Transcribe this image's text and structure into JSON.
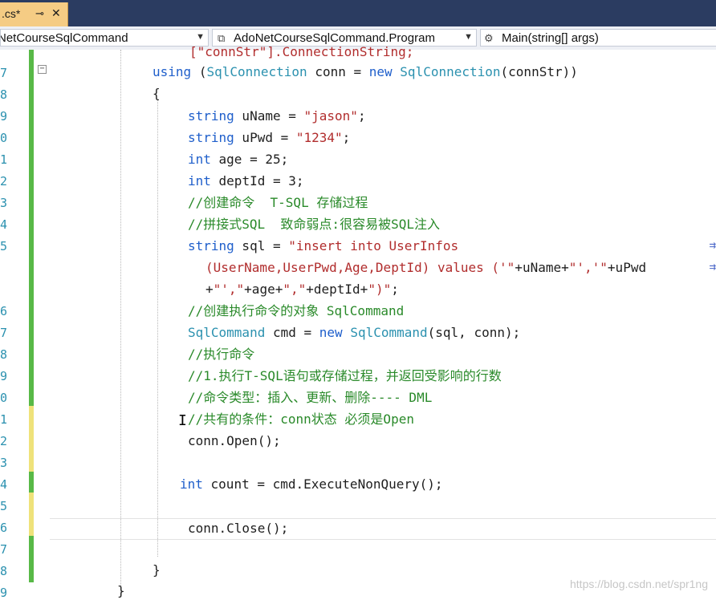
{
  "tab": {
    "title": ".cs*",
    "pin": "⊸",
    "close": "✕"
  },
  "nav": {
    "project": "NetCourseSqlCommand",
    "class": "AdoNetCourseSqlCommand.Program",
    "member": "Main(string[] args)"
  },
  "line_numbers": [
    "7",
    "8",
    "9",
    "0",
    "1",
    "2",
    "3",
    "4",
    "5",
    "6",
    "7",
    "8",
    "9",
    "0",
    "1",
    "2",
    "3",
    "4",
    "5",
    "6",
    "7",
    "8",
    "9"
  ],
  "code": {
    "l0": "[\"connStr\"].ConnectionString;",
    "l1_kw": "using",
    "l1_a": "(",
    "l1_ty": "SqlConnection",
    "l1_b": " conn = ",
    "l1_new": "new",
    "l1_ty2": "SqlConnection",
    "l1_c": "(connStr))",
    "l2": "{",
    "l3_kw": "string",
    "l3_a": " uName = ",
    "l3_st": "\"jason\"",
    "l3_b": ";",
    "l4_kw": "string",
    "l4_a": " uPwd = ",
    "l4_st": "\"1234\"",
    "l4_b": ";",
    "l5_kw": "int",
    "l5_a": " age = 25;",
    "l6_kw": "int",
    "l6_a": " deptId = 3;",
    "l7": "//创建命令  T-SQL 存储过程",
    "l8": "//拼接式SQL  致命弱点:很容易被SQL注入",
    "l9_kw": "string",
    "l9_a": " sql = ",
    "l9_st": "\"insert into UserInfos",
    "l10_st": "(UserName,UserPwd,Age,DeptId) values ('\"",
    "l10_a": "+uName+",
    "l10_st2": "\"','\"",
    "l10_b": "+uPwd",
    "l11_a": "+",
    "l11_st": "\"',\"",
    "l11_b": "+age+",
    "l11_st2": "\",\"",
    "l11_c": "+deptId+",
    "l11_st3": "\")\"",
    "l11_d": ";",
    "l12": "//创建执行命令的对象 SqlCommand",
    "l13_ty": "SqlCommand",
    "l13_a": " cmd = ",
    "l13_new": "new",
    "l13_ty2": "SqlCommand",
    "l13_b": "(sql, conn);",
    "l14": "//执行命令",
    "l15": "//1.执行T-SQL语句或存储过程，并返回受影响的行数",
    "l16": "//命令类型：插入、更新、删除---- DML",
    "l17": "//共有的条件：conn状态 必须是Open",
    "l18": "conn.Open();",
    "l19_kw": "int",
    "l19_a": " count = cmd.ExecuteNonQuery();",
    "l20": "conn.Close();",
    "l21": "}",
    "l22": "}"
  },
  "continuation_glyph": "⇉",
  "cursor_glyph": "I",
  "watermark": "https://blog.csdn.net/spr1ng"
}
